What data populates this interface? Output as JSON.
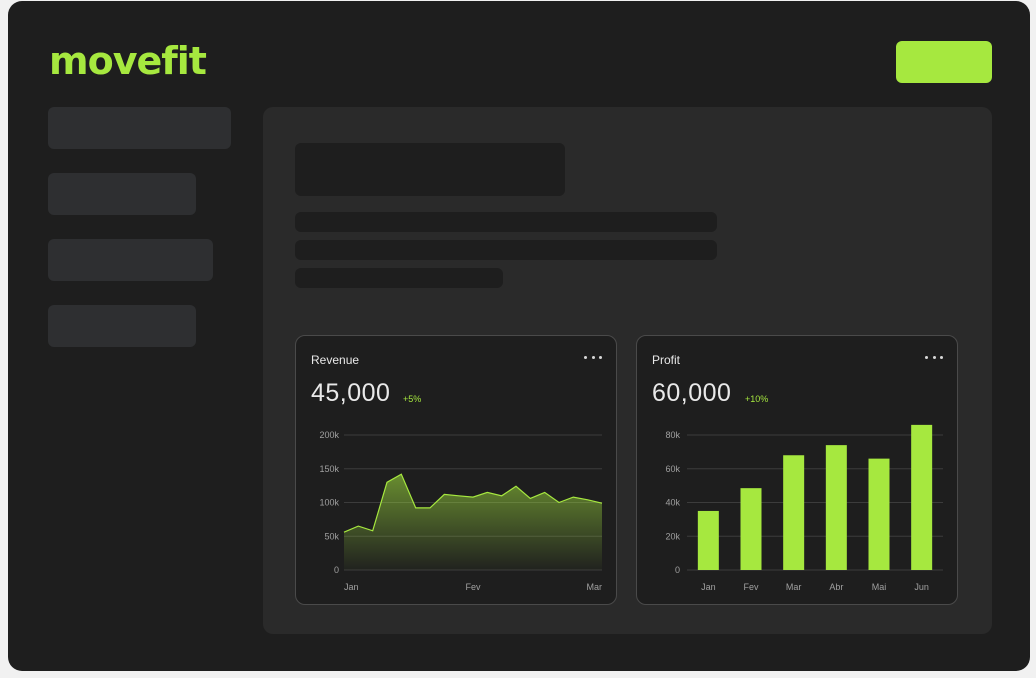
{
  "app": {
    "logo": "movefit",
    "accent": "#a6e83f"
  },
  "header": {
    "cta_label": ""
  },
  "cards": {
    "revenue": {
      "title": "Revenue",
      "value": "45,000",
      "delta": "+5%"
    },
    "profit": {
      "title": "Profit",
      "value": "60,000",
      "delta": "+10%"
    }
  },
  "chart_data": [
    {
      "type": "area",
      "title": "Revenue",
      "x_tick_labels": [
        "Jan",
        "Fev",
        "Mar"
      ],
      "y_tick_labels": [
        "0",
        "50k",
        "100k",
        "150k",
        "200k"
      ],
      "ylim": [
        0,
        200000
      ],
      "grid": true,
      "values": [
        56000,
        65000,
        58000,
        130000,
        142000,
        92000,
        92000,
        112000,
        110000,
        108000,
        115000,
        110000,
        124000,
        106000,
        115000,
        100000,
        108000,
        104000,
        99000
      ]
    },
    {
      "type": "bar",
      "title": "Profit",
      "categories": [
        "Jan",
        "Fev",
        "Mar",
        "Abr",
        "Mai",
        "Jun"
      ],
      "y_tick_labels": [
        "0",
        "20k",
        "40k",
        "60k",
        "80k"
      ],
      "ylim": [
        0,
        80000
      ],
      "grid": true,
      "values": [
        35000,
        48500,
        68000,
        74000,
        66000,
        86000
      ]
    }
  ]
}
